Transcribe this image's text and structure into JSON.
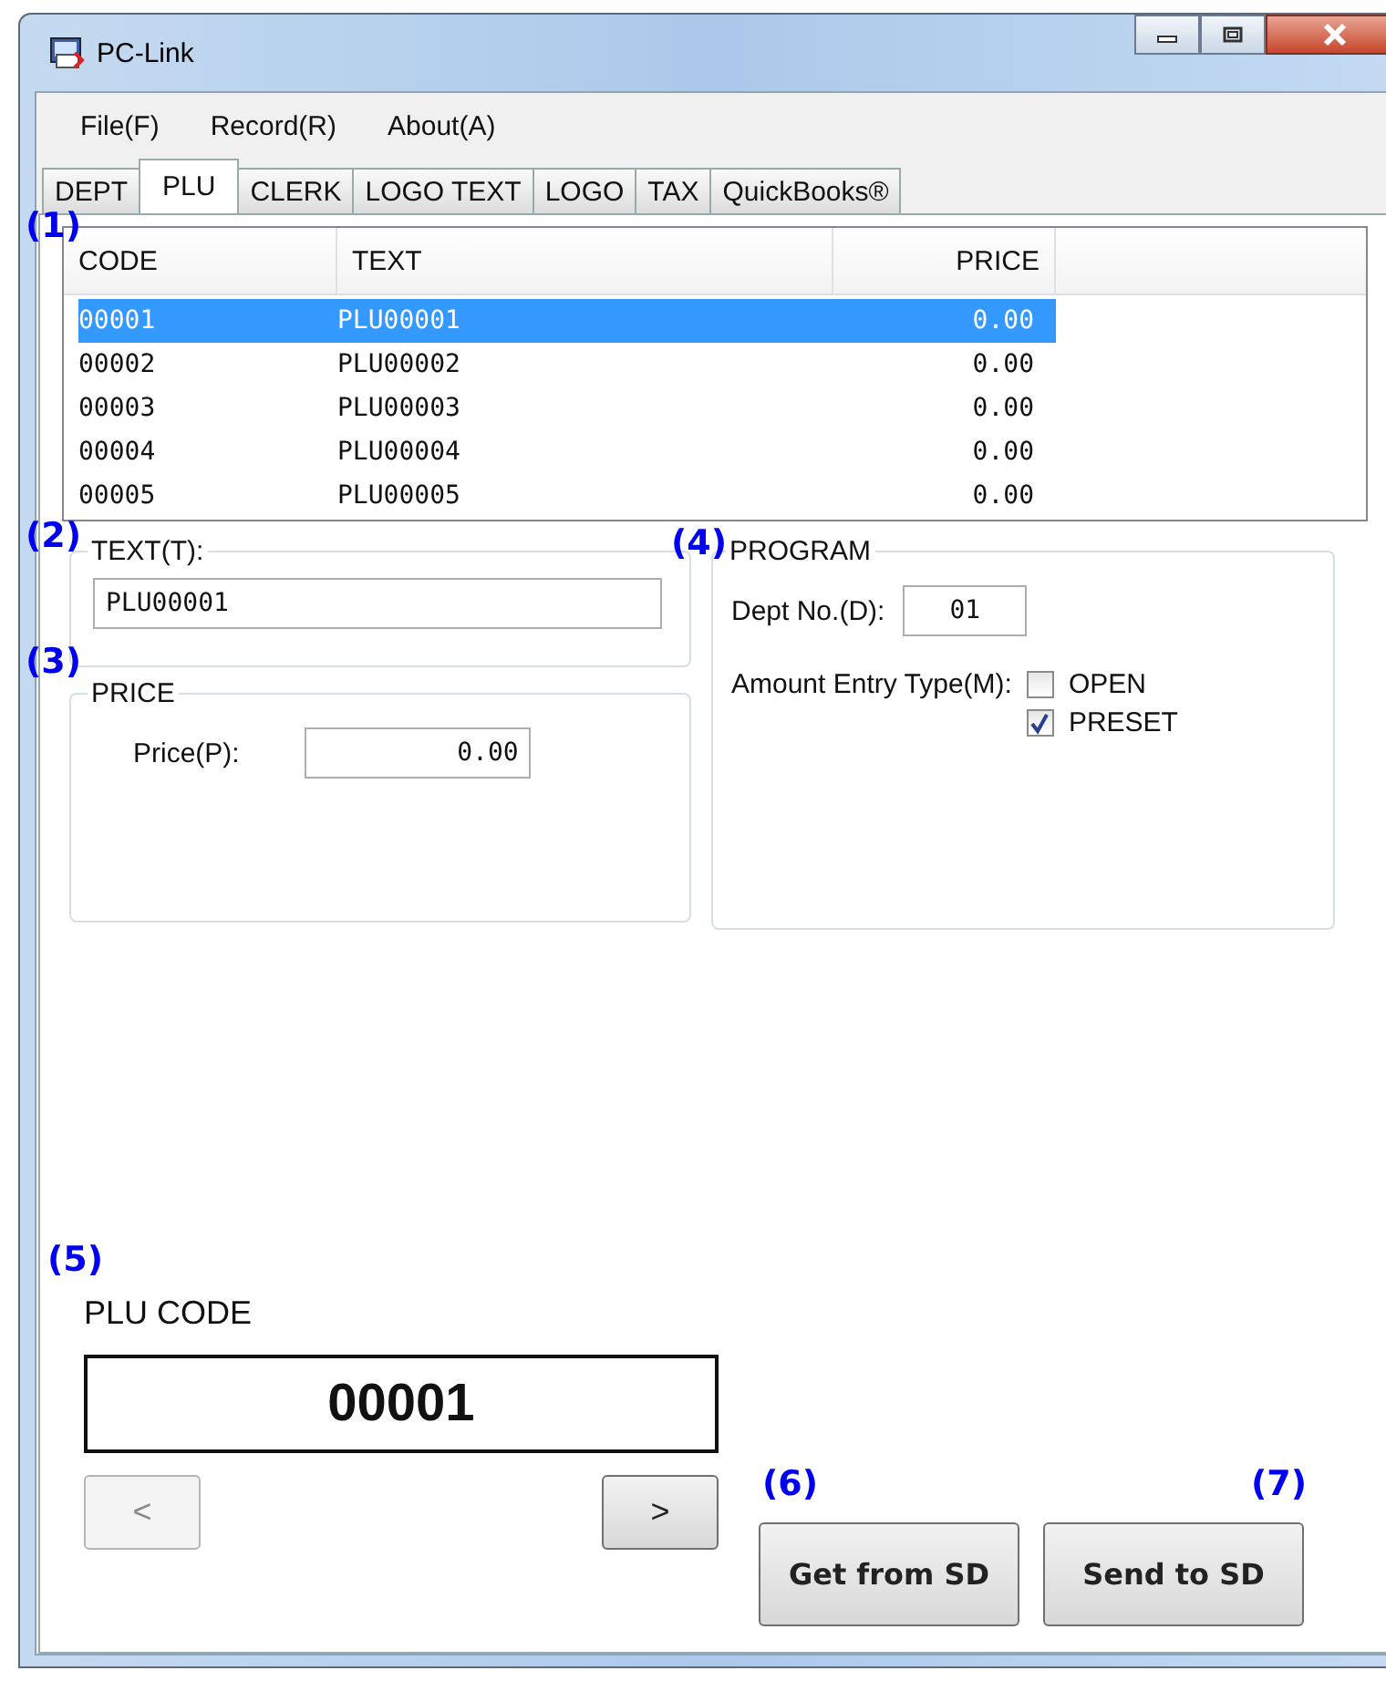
{
  "window": {
    "title": "PC-Link"
  },
  "menu": [
    "File(F)",
    "Record(R)",
    "About(A)"
  ],
  "tabs": [
    {
      "label": "DEPT",
      "selected": false
    },
    {
      "label": "PLU",
      "selected": true
    },
    {
      "label": "CLERK",
      "selected": false
    },
    {
      "label": "LOGO TEXT",
      "selected": false
    },
    {
      "label": "LOGO",
      "selected": false
    },
    {
      "label": "TAX",
      "selected": false
    },
    {
      "label": "QuickBooks®",
      "selected": false
    }
  ],
  "list": {
    "columns": [
      "CODE",
      "TEXT",
      "PRICE"
    ],
    "rows": [
      {
        "code": "00001",
        "text": "PLU00001",
        "price": "0.00",
        "selected": true
      },
      {
        "code": "00002",
        "text": "PLU00002",
        "price": "0.00",
        "selected": false
      },
      {
        "code": "00003",
        "text": "PLU00003",
        "price": "0.00",
        "selected": false
      },
      {
        "code": "00004",
        "text": "PLU00004",
        "price": "0.00",
        "selected": false
      },
      {
        "code": "00005",
        "text": "PLU00005",
        "price": "0.00",
        "selected": false
      }
    ]
  },
  "text_group": {
    "legend": "TEXT(T):",
    "value": "PLU00001"
  },
  "price_group": {
    "legend": "PRICE",
    "label": "Price(P):",
    "value": "0.00"
  },
  "program_group": {
    "legend": "PROGRAM",
    "dept_label": "Dept No.(D):",
    "dept_value": "01",
    "amount_label": "Amount Entry Type(M):",
    "options": [
      {
        "label": "OPEN",
        "checked": false
      },
      {
        "label": "PRESET",
        "checked": true
      }
    ]
  },
  "plu_code": {
    "label": "PLU CODE",
    "value": "00001"
  },
  "nav_buttons": [
    {
      "label": "<",
      "disabled": true
    },
    {
      "label": ">",
      "disabled": false
    }
  ],
  "buttons": [
    "Get from SD",
    "Send to SD"
  ],
  "callouts": [
    "(1)",
    "(2)",
    "(3)",
    "(4)",
    "(5)",
    "(6)",
    "(7)"
  ]
}
